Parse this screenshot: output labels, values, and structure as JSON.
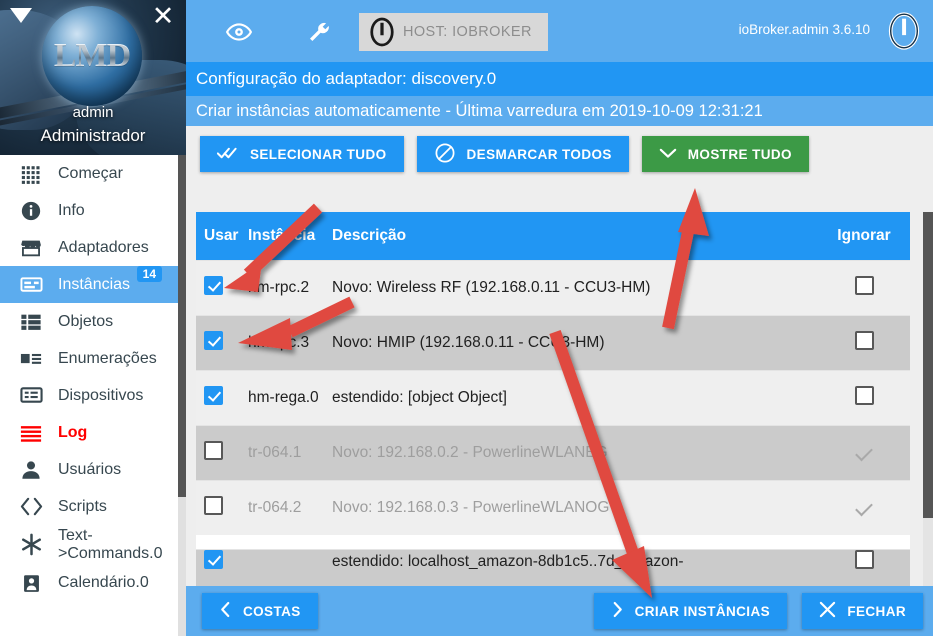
{
  "sidebar": {
    "user": "admin",
    "role": "Administrador",
    "logo_text": "LMD",
    "caret_icon": "caret-down-icon",
    "close_icon": "close-icon",
    "items": [
      {
        "label": "Começar",
        "icon": "grid-apps-icon",
        "selected": false,
        "danger": false,
        "badge": ""
      },
      {
        "label": "Info",
        "icon": "info-icon",
        "selected": false,
        "danger": false,
        "badge": ""
      },
      {
        "label": "Adaptadores",
        "icon": "store-icon",
        "selected": false,
        "danger": false,
        "badge": ""
      },
      {
        "label": "Instâncias",
        "icon": "instances-icon",
        "selected": true,
        "danger": false,
        "badge": "14"
      },
      {
        "label": "Objetos",
        "icon": "objects-list-icon",
        "selected": false,
        "danger": false,
        "badge": ""
      },
      {
        "label": "Enumerações",
        "icon": "enum-icon",
        "selected": false,
        "danger": false,
        "badge": ""
      },
      {
        "label": "Dispositivos",
        "icon": "devices-icon",
        "selected": false,
        "danger": false,
        "badge": ""
      },
      {
        "label": "Log",
        "icon": "log-lines-icon",
        "selected": false,
        "danger": true,
        "badge": ""
      },
      {
        "label": "Usuários",
        "icon": "user-icon",
        "selected": false,
        "danger": false,
        "badge": ""
      },
      {
        "label": "Scripts",
        "icon": "code-brackets-icon",
        "selected": false,
        "danger": false,
        "badge": ""
      },
      {
        "label": "Text->Commands.0",
        "icon": "asterisk-icon",
        "selected": false,
        "danger": false,
        "badge": ""
      },
      {
        "label": "Calendário.0",
        "icon": "calendar-icon",
        "selected": false,
        "danger": false,
        "badge": ""
      }
    ]
  },
  "topbar": {
    "eye_icon": "eye-icon",
    "wrench_icon": "wrench-icon",
    "host_label": "HOST: IOBROKER",
    "host_icon": "iobroker-logo-icon",
    "version": "ioBroker.admin 3.6.10",
    "logo_icon": "iobroker-logo-icon"
  },
  "headers": {
    "title": "Configuração do adaptador: discovery.0",
    "subtitle": "Criar instâncias automaticamente - Última varredura em 2019-10-09 12:31:21"
  },
  "actions": {
    "select_all": {
      "label": "SELECIONAR TUDO",
      "icon": "double-check-icon"
    },
    "unselect_all": {
      "label": "DESMARCAR TODOS",
      "icon": "block-circle-icon"
    },
    "show_all": {
      "label": "MOSTRE TUDO",
      "icon": "chevron-down-icon"
    }
  },
  "table": {
    "columns": [
      "Usar",
      "Instância",
      "Descrição",
      "Ignorar"
    ],
    "rows": [
      {
        "use": true,
        "instance": "hm-rpc.2",
        "description": "Novo: Wireless RF (192.168.0.11 - CCU3-HM)",
        "ignore": "box",
        "dim": false
      },
      {
        "use": true,
        "instance": "hm-rpc.3",
        "description": "Novo: HMIP (192.168.0.11 - CCU3-HM)",
        "ignore": "box",
        "dim": false
      },
      {
        "use": true,
        "instance": "hm-rega.0",
        "description": "estendido: [object Object]",
        "ignore": "box",
        "dim": false
      },
      {
        "use": false,
        "instance": "tr-064.1",
        "description": "Novo: 192.168.0.2 - PowerlineWLANEG",
        "ignore": "tick",
        "dim": true
      },
      {
        "use": false,
        "instance": "tr-064.2",
        "description": "Novo: 192.168.0.3 - PowerlineWLANOG",
        "ignore": "tick",
        "dim": true
      }
    ],
    "partial_row": {
      "use": true,
      "instance": "",
      "description": "estendido: localhost_amazon-8db1c5..7d_amazon-",
      "ignore": "box"
    }
  },
  "bottombar": {
    "back": {
      "label": "COSTAS",
      "icon": "chevron-left-icon"
    },
    "create": {
      "label": "CRIAR INSTÂNCIAS",
      "icon": "chevron-right-icon"
    },
    "close": {
      "label": "FECHAR",
      "icon": "x-icon"
    }
  },
  "annotations": {
    "arrow_color": "#e04a3f",
    "arrows": [
      {
        "name": "arrow-to-hm-rpc2-checkbox"
      },
      {
        "name": "arrow-to-hm-rpc3-checkbox"
      },
      {
        "name": "arrow-to-mostre-tudo-button"
      },
      {
        "name": "arrow-to-criar-instancias-button"
      }
    ]
  },
  "colors": {
    "primary_blue": "#2196f3",
    "light_blue": "#5cacee",
    "green": "#3c9a46",
    "danger_red": "#ff0000"
  }
}
